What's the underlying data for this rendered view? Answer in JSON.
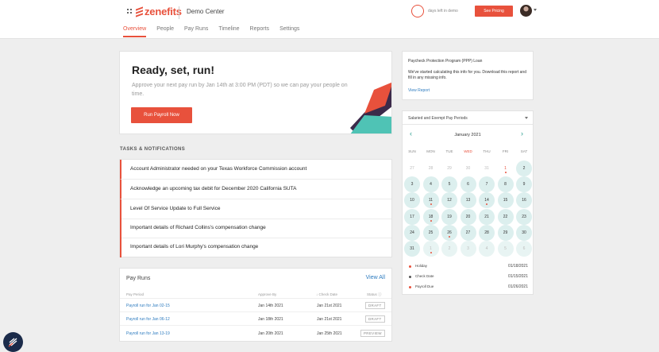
{
  "header": {
    "logo_text": "zenefits",
    "company": "Demo Center",
    "days_left_count": "",
    "days_left_text": "days left in demo",
    "see_pricing": "See Pricing",
    "nav": [
      "Overview",
      "People",
      "Pay Runs",
      "Timeline",
      "Reports",
      "Settings"
    ]
  },
  "hero": {
    "title": "Ready, set, run!",
    "text": "Approve your next pay run by Jan 14th at 3:00 PM (PDT) so we can pay your people on time.",
    "button": "Run Payroll Now"
  },
  "tasks": {
    "heading": "TASKS & NOTIFICATIONS",
    "items": [
      "Account Administrator needed on your Texas Workforce Commission account",
      "Acknowledge an upcoming tax debit for December 2020 California SUTA",
      "Level Of Service Update to Full Service",
      "Important details of Richard Collins's compensation change",
      "Important details of Lori Murphy's compensation change"
    ]
  },
  "payruns": {
    "title": "Pay Runs",
    "view_all": "View All",
    "columns": [
      "Pay Period",
      "Approve By",
      "↓ Check Date",
      "Status ⓘ"
    ],
    "rows": [
      {
        "period": "Payroll run for Jan 02-15",
        "approve_by": "Jan 14th 2021",
        "check_date": "Jan 21st 2021",
        "status": "DRAFT"
      },
      {
        "period": "Payroll run for Jan 06-12",
        "approve_by": "Jan 18th 2021",
        "check_date": "Jan 21st 2021",
        "status": "DRAFT"
      },
      {
        "period": "Payroll run for Jan 13-19",
        "approve_by": "Jan 20th 2021",
        "check_date": "Jan 25th 2021",
        "status": "PREVIEW"
      }
    ]
  },
  "ppp": {
    "title": "Paycheck Protection Program (PPP) Loan",
    "text": "We've started calculating this info for you. Download this report and fill in any missing info.",
    "link": "View Report"
  },
  "calendar": {
    "select_label": "Salaried and Exempt Pay Periods",
    "month": "January 2021",
    "weekdays": [
      "SUN",
      "MON",
      "TUE",
      "WED",
      "THU",
      "FRI",
      "SAT"
    ],
    "weeks": [
      [
        "27",
        "28",
        "29",
        "30",
        "31",
        "1",
        "2"
      ],
      [
        "3",
        "4",
        "5",
        "6",
        "7",
        "8",
        "9"
      ],
      [
        "10",
        "11",
        "12",
        "13",
        "14",
        "15",
        "16"
      ],
      [
        "17",
        "18",
        "19",
        "20",
        "21",
        "22",
        "23"
      ],
      [
        "24",
        "25",
        "26",
        "27",
        "28",
        "29",
        "30"
      ],
      [
        "31",
        "1",
        "2",
        "3",
        "4",
        "5",
        "6"
      ]
    ],
    "legend": [
      {
        "label": "Holiday",
        "date": "01/18/2021",
        "color": "#e8513c"
      },
      {
        "label": "Check Date",
        "date": "01/15/2021",
        "color": "#555555"
      },
      {
        "label": "Payroll Due",
        "date": "01/26/2021",
        "color": "#e8513c"
      }
    ]
  },
  "colors": {
    "accent": "#e8513c",
    "link": "#2d7bbf",
    "teal": "#2a9d8f",
    "pay_period": "#dcefee"
  }
}
